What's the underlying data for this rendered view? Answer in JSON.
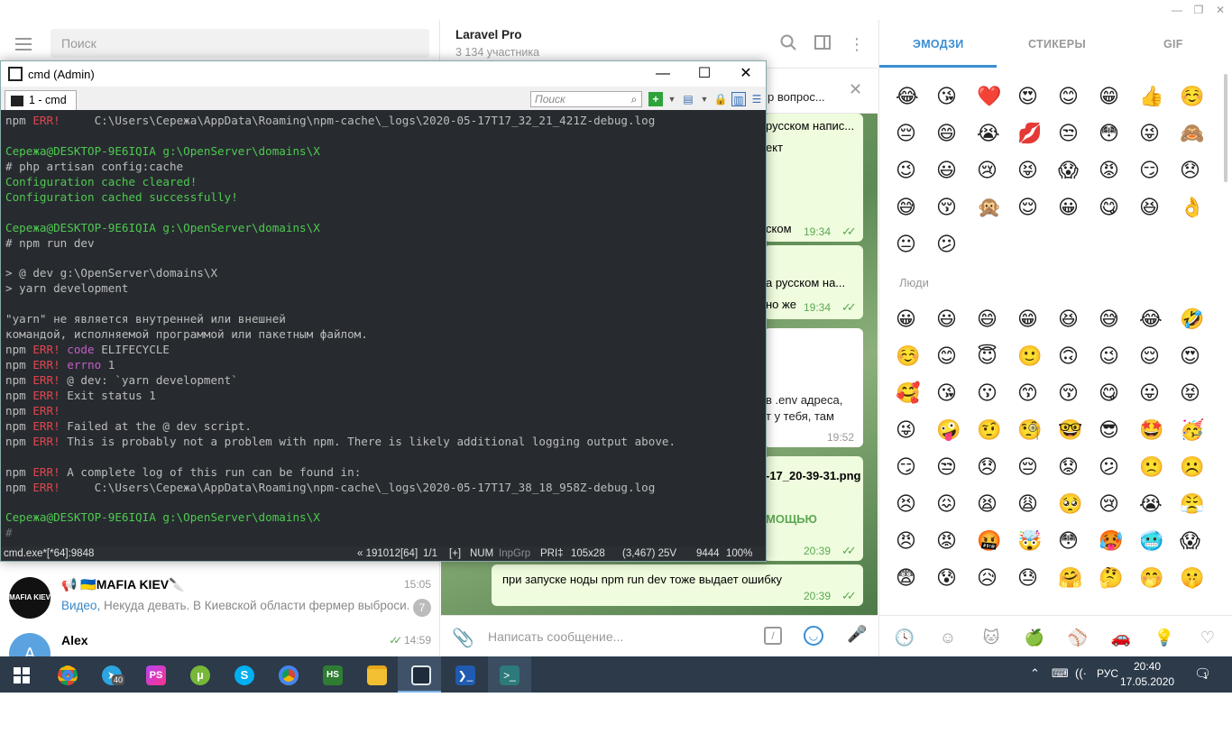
{
  "telegram": {
    "search_placeholder": "Поиск",
    "chat_title": "Laravel Pro",
    "chat_subtitle": "3 134 участника",
    "pinned_fragment": "р вопрос...",
    "chats": [
      {
        "name": "📢 🇺🇦MAFIA KIEV🔪",
        "time": "15:05",
        "preview_kind": "Видео,",
        "preview": " Некуда девать.  В Киевской области фермер выброси...",
        "unread": "7",
        "avatar_text": "MAFIA KIEV"
      },
      {
        "name": "Alex",
        "time": "14:59",
        "preview_kind": "",
        "preview": "",
        "unread": "",
        "avatar_text": "A"
      }
    ],
    "messages": [
      {
        "text": "русском напис...",
        "time": ""
      },
      {
        "text": "ект",
        "time": ""
      },
      {
        "text": "ском",
        "time": "19:34"
      },
      {
        "text": "а русском на...",
        "time": ""
      },
      {
        "text": "но же",
        "time": "19:34"
      },
      {
        "text": "в .env адреса,",
        "time": ""
      },
      {
        "text": "т у тебя, там",
        "time": "19:52"
      },
      {
        "text": "-17_20-39-31.png",
        "time": ""
      },
      {
        "text": "МОЩЬЮ",
        "time": "20:39"
      },
      {
        "text": "при запуске ноды npm run dev тоже выдает ошибку",
        "time": "20:39"
      }
    ],
    "composer_placeholder": "Написать сообщение..."
  },
  "emoji_panel": {
    "tabs": [
      "ЭМОДЗИ",
      "СТИКЕРЫ",
      "GIF"
    ],
    "people_label": "Люди",
    "recent": [
      "😂",
      "😘",
      "❤️",
      "😍",
      "😊",
      "😁",
      "👍",
      "☺️",
      "😔",
      "😄",
      "😭",
      "💋",
      "😒",
      "😳",
      "😜",
      "🙈",
      "😉",
      "😃",
      "😢",
      "😝",
      "😱",
      "😡",
      "😏",
      "😞",
      "😅",
      "😚",
      "🙊",
      "😌",
      "😀",
      "😋",
      "😆",
      "👌",
      "😐",
      "😕"
    ],
    "people": [
      "😀",
      "😃",
      "😄",
      "😁",
      "😆",
      "😅",
      "😂",
      "🤣",
      "☺️",
      "😊",
      "😇",
      "🙂",
      "🙃",
      "😉",
      "😌",
      "😍",
      "🥰",
      "😘",
      "😗",
      "😙",
      "😚",
      "😋",
      "😛",
      "😝",
      "😜",
      "🤪",
      "🤨",
      "🧐",
      "🤓",
      "😎",
      "🤩",
      "🥳",
      "😏",
      "😒",
      "😞",
      "😔",
      "😟",
      "😕",
      "🙁",
      "☹️",
      "😣",
      "😖",
      "😫",
      "😩",
      "🥺",
      "😢",
      "😭",
      "😤",
      "😠",
      "😡",
      "🤬",
      "🤯",
      "😳",
      "🥵",
      "🥶",
      "😱",
      "😨",
      "😰",
      "😥",
      "😓",
      "🤗",
      "🤔",
      "🤭",
      "🤫"
    ]
  },
  "cmd": {
    "title": "cmd (Admin)",
    "tab": "1 - cmd",
    "search_placeholder": "Поиск",
    "lines": [
      [
        [
          "c-gray",
          "npm "
        ],
        [
          "c-red",
          "ERR!"
        ],
        [
          "c-gray",
          "     C:\\Users\\Сережа\\AppData\\Roaming\\npm-cache\\_logs\\2020-05-17T17_32_21_421Z-debug.log"
        ]
      ],
      [],
      [
        [
          "c-green",
          "Сережа@DESKTOP-9E6IQIA g:\\OpenServer\\domains\\X"
        ]
      ],
      [
        [
          "c-gray",
          "# php artisan config:cache"
        ]
      ],
      [
        [
          "c-green",
          "Configuration cache cleared!"
        ]
      ],
      [
        [
          "c-green",
          "Configuration cached successfully!"
        ]
      ],
      [],
      [
        [
          "c-green",
          "Сережа@DESKTOP-9E6IQIA g:\\OpenServer\\domains\\X"
        ]
      ],
      [
        [
          "c-gray",
          "# npm run dev"
        ]
      ],
      [],
      [
        [
          "c-gray",
          "> @ dev g:\\OpenServer\\domains\\X"
        ]
      ],
      [
        [
          "c-gray",
          "> yarn development"
        ]
      ],
      [],
      [
        [
          "c-gray",
          "\"yarn\" не является внутренней или внешней"
        ]
      ],
      [
        [
          "c-gray",
          "командой, исполняемой программой или пакетным файлом."
        ]
      ],
      [
        [
          "c-gray",
          "npm "
        ],
        [
          "c-red",
          "ERR!"
        ],
        [
          "c-mag",
          " code"
        ],
        [
          "c-gray",
          " ELIFECYCLE"
        ]
      ],
      [
        [
          "c-gray",
          "npm "
        ],
        [
          "c-red",
          "ERR!"
        ],
        [
          "c-mag",
          " errno"
        ],
        [
          "c-gray",
          " 1"
        ]
      ],
      [
        [
          "c-gray",
          "npm "
        ],
        [
          "c-red",
          "ERR!"
        ],
        [
          "c-gray",
          " @ dev: `yarn development`"
        ]
      ],
      [
        [
          "c-gray",
          "npm "
        ],
        [
          "c-red",
          "ERR!"
        ],
        [
          "c-gray",
          " Exit status 1"
        ]
      ],
      [
        [
          "c-gray",
          "npm "
        ],
        [
          "c-red",
          "ERR!"
        ]
      ],
      [
        [
          "c-gray",
          "npm "
        ],
        [
          "c-red",
          "ERR!"
        ],
        [
          "c-gray",
          " Failed at the @ dev script."
        ]
      ],
      [
        [
          "c-gray",
          "npm "
        ],
        [
          "c-red",
          "ERR!"
        ],
        [
          "c-gray",
          " This is probably not a problem with npm. There is likely additional logging output above."
        ]
      ],
      [],
      [
        [
          "c-gray",
          "npm "
        ],
        [
          "c-red",
          "ERR!"
        ],
        [
          "c-gray",
          " A complete log of this run can be found in:"
        ]
      ],
      [
        [
          "c-gray",
          "npm "
        ],
        [
          "c-red",
          "ERR!"
        ],
        [
          "c-gray",
          "     C:\\Users\\Сережа\\AppData\\Roaming\\npm-cache\\_logs\\2020-05-17T17_38_18_958Z-debug.log"
        ]
      ],
      [],
      [
        [
          "c-green",
          "Сережа@DESKTOP-9E6IQIA g:\\OpenServer\\domains\\X"
        ]
      ],
      [
        [
          "c-dim",
          "#"
        ]
      ]
    ],
    "status": {
      "process": "cmd.exe*[*64]:9848",
      "build": "« 191012[64]",
      "page": "1/1",
      "ins": "[+]",
      "num": "NUM",
      "inpgrp": "InpGrp",
      "pri": "PRI‡",
      "size": "105x28",
      "cursor": "(3,467) 25V",
      "pid": "9444",
      "zoom": "100%"
    }
  },
  "taskbar": {
    "lang": "РУС",
    "time": "20:40",
    "date": "17.05.2020",
    "telegram_badge": "40",
    "notifications": "1"
  }
}
